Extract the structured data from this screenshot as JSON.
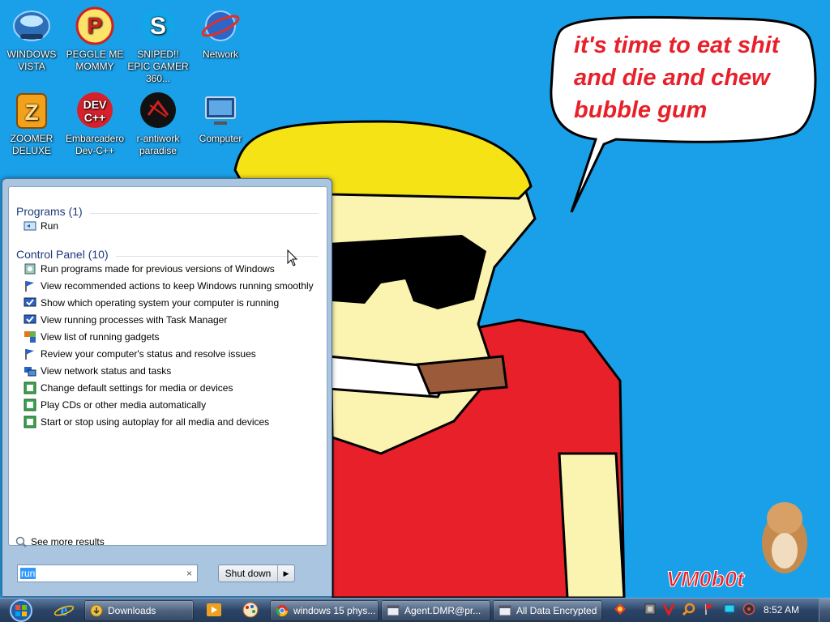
{
  "wallpaper": {
    "speech_text": "it's time to eat shit and die and chew bubble gum",
    "signature": "VM0b0t",
    "colors": {
      "sky": "#1aa0e8",
      "hair": "#f5e316",
      "skin": "#fbf3b0",
      "shirt": "#e8202a",
      "cigar": "#9b5a3a"
    }
  },
  "desktop_icons": [
    {
      "label": "WINDOWS VISTA",
      "icon": "vista-orb-icon"
    },
    {
      "label": "PEGGLE ME MOMMY",
      "icon": "peggle-icon"
    },
    {
      "label": "SNIPED!! EPIC GAMER 360...",
      "icon": "skype-icon"
    },
    {
      "label": "Network",
      "icon": "network-icon"
    },
    {
      "label": "ZOOMER DELUXE",
      "icon": "zoomer-icon"
    },
    {
      "label": "Embarcadero Dev-C++",
      "icon": "devcpp-icon"
    },
    {
      "label": "r-antiwork paradise",
      "icon": "antiwork-icon"
    },
    {
      "label": "Computer",
      "icon": "computer-icon"
    }
  ],
  "start_menu": {
    "programs_title": "Programs (1)",
    "programs": [
      {
        "label": "Run",
        "icon": "run-icon"
      }
    ],
    "control_panel_title": "Control Panel (10)",
    "control_panel": [
      {
        "label": "Run programs made for previous versions of Windows",
        "icon": "compat-icon"
      },
      {
        "label": "View recommended actions to keep Windows running smoothly",
        "icon": "flag-icon"
      },
      {
        "label": "Show which operating system your computer is running",
        "icon": "system-icon"
      },
      {
        "label": "View running processes with Task Manager",
        "icon": "system-icon"
      },
      {
        "label": "View list of running gadgets",
        "icon": "gadgets-icon"
      },
      {
        "label": "Review your computer's status and resolve issues",
        "icon": "flag-icon"
      },
      {
        "label": "View network status and tasks",
        "icon": "network-icon"
      },
      {
        "label": "Change default settings for media or devices",
        "icon": "autoplay-icon"
      },
      {
        "label": "Play CDs or other media automatically",
        "icon": "autoplay-icon"
      },
      {
        "label": "Start or stop using autoplay for all media and devices",
        "icon": "autoplay-icon"
      }
    ],
    "see_more": "See more results",
    "search_value": "run",
    "search_clear": "×",
    "shutdown_label": "Shut down",
    "shutdown_arrow": "▶"
  },
  "taskbar": {
    "buttons": [
      {
        "label": "Downloads",
        "icon": "folder-icon"
      },
      {
        "label": "windows 15 phys...",
        "icon": "chrome-icon"
      },
      {
        "label": "Agent.DMR@pr...",
        "icon": "window-icon"
      },
      {
        "label": "All Data Encrypted",
        "icon": "window-icon"
      }
    ],
    "clock": "8:52 AM"
  }
}
